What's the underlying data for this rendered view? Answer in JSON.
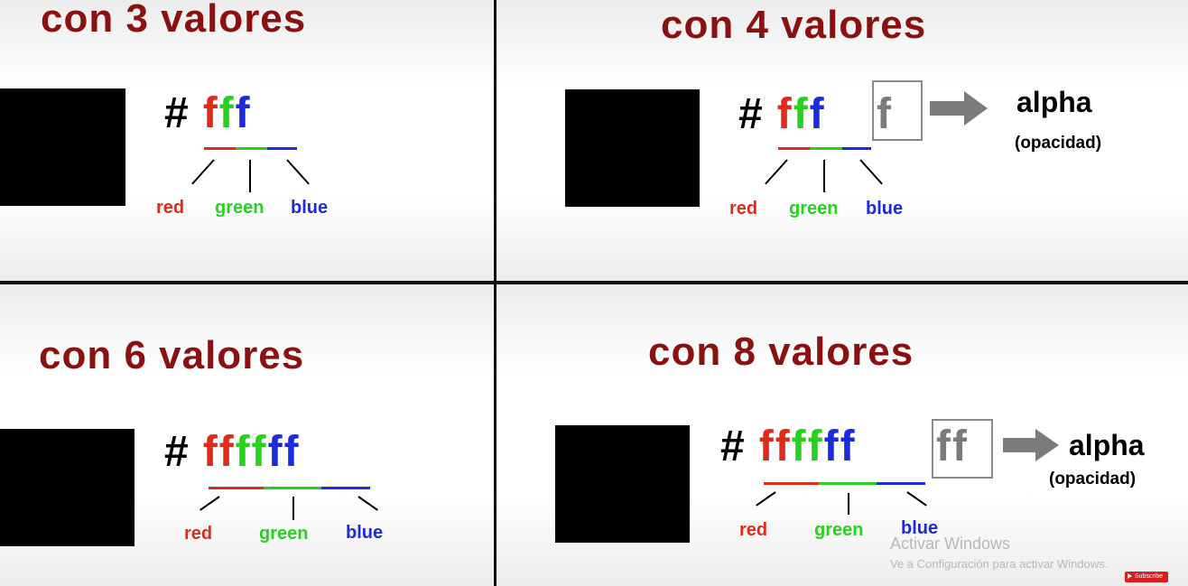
{
  "panels": [
    {
      "title": "con 3 valores",
      "hash": "#",
      "chars": [
        "f",
        "f",
        "f"
      ],
      "labels": {
        "red": "red",
        "green": "green",
        "blue": "blue"
      }
    },
    {
      "title": "con 4 valores",
      "hash": "#",
      "chars": [
        "f",
        "f",
        "f"
      ],
      "alpha_chars": "f",
      "alpha_label": "alpha",
      "alpha_sub": "(opacidad)",
      "labels": {
        "red": "red",
        "green": "green",
        "blue": "blue"
      }
    },
    {
      "title": "con 6 valores",
      "hash": "#",
      "chars": [
        "ff",
        "ff",
        "ff"
      ],
      "labels": {
        "red": "red",
        "green": "green",
        "blue": "blue"
      }
    },
    {
      "title": "con 8 valores",
      "hash": "#",
      "chars": [
        "ff",
        "ff",
        "ff"
      ],
      "alpha_chars": "ff",
      "alpha_label": "alpha",
      "alpha_sub": "(opacidad)",
      "labels": {
        "red": "red",
        "green": "green",
        "blue": "blue"
      }
    }
  ],
  "watermark": {
    "line1": "Activar Windows",
    "line2": "Ve a Configuración para activar Windows."
  },
  "subscribe_badge": "Subscribe",
  "colors": {
    "title": "#8b1010",
    "red": "#e02b1a",
    "green": "#27d21f",
    "blue": "#1c2bdc",
    "alpha": "#7b7b7b"
  }
}
